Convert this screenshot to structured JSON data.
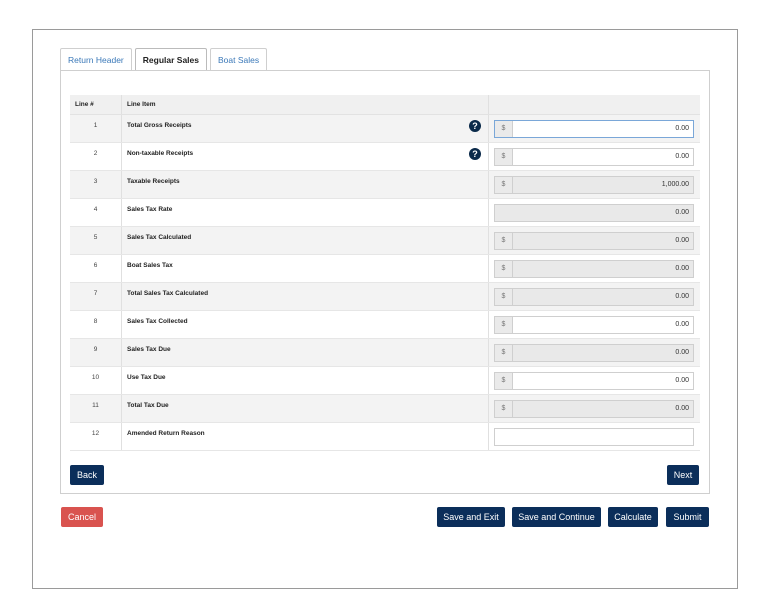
{
  "tabs": [
    "Return Header",
    "Regular Sales",
    "Boat Sales"
  ],
  "table": {
    "headers": [
      "Line #",
      "Line Item",
      ""
    ],
    "rows": [
      {
        "num": "1",
        "label": "Total Gross Receipts",
        "value": "0.00"
      },
      {
        "num": "2",
        "label": "Non-taxable Receipts",
        "value": "0.00"
      },
      {
        "num": "3",
        "label": "Taxable Receipts",
        "value": "1,000.00"
      },
      {
        "num": "4",
        "label": "Sales Tax Rate",
        "value": "0.00"
      },
      {
        "num": "5",
        "label": "Sales Tax Calculated",
        "value": "0.00"
      },
      {
        "num": "6",
        "label": "Boat Sales Tax",
        "value": "0.00"
      },
      {
        "num": "7",
        "label": "Total Sales Tax Calculated",
        "value": "0.00"
      },
      {
        "num": "8",
        "label": "Sales Tax Collected",
        "value": "0.00"
      },
      {
        "num": "9",
        "label": "Sales Tax Due",
        "value": "0.00"
      },
      {
        "num": "10",
        "label": "Use Tax Due",
        "value": "0.00"
      },
      {
        "num": "11",
        "label": "Total Tax Due",
        "value": "0.00"
      },
      {
        "num": "12",
        "label": "Amended Return Reason",
        "value": ""
      }
    ],
    "currency_symbol": "$"
  },
  "buttons": {
    "back": "Back",
    "next": "Next",
    "cancel": "Cancel",
    "save_exit": "Save and Exit",
    "save_continue": "Save and Continue",
    "calculate": "Calculate",
    "submit": "Submit"
  },
  "icons": {
    "help": "question-circle-icon"
  },
  "colors": {
    "primary": "#0b2e5a",
    "danger": "#d9534f",
    "link": "#3a78b8"
  }
}
